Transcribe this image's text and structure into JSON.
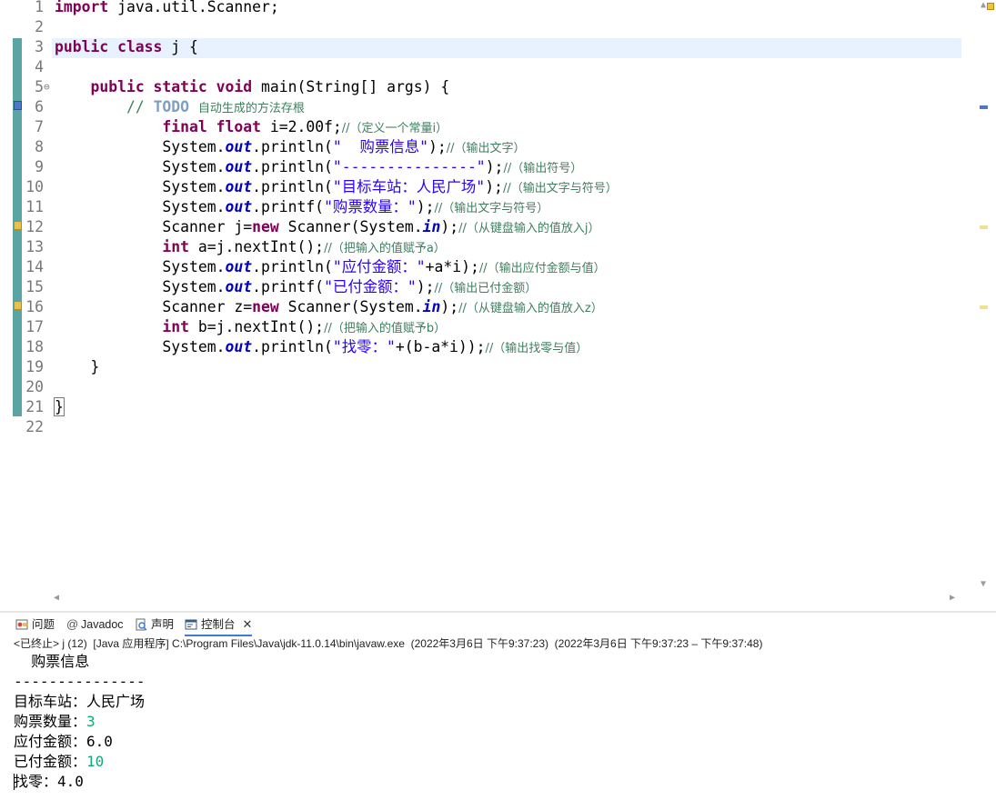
{
  "editor": {
    "lines": [
      {
        "num": "1",
        "segs": [
          {
            "t": "import",
            "c": "kw"
          },
          {
            "t": " java.util.Scanner;",
            "c": ""
          }
        ]
      },
      {
        "num": "2",
        "segs": []
      },
      {
        "num": "3",
        "segs": [
          {
            "t": "public class",
            "c": "kw"
          },
          {
            "t": " j {",
            "c": ""
          }
        ]
      },
      {
        "num": "4",
        "segs": []
      },
      {
        "num": "5",
        "fold": "⊖",
        "segs": [
          {
            "t": "    ",
            "c": ""
          },
          {
            "t": "public static void",
            "c": "kw"
          },
          {
            "t": " main(String[] ",
            "c": ""
          },
          {
            "t": "args",
            "c": "var"
          },
          {
            "t": ") {",
            "c": ""
          }
        ]
      },
      {
        "num": "6",
        "segs": [
          {
            "t": "        ",
            "c": ""
          },
          {
            "t": "// ",
            "c": "cmt"
          },
          {
            "t": "TODO",
            "c": "todo"
          },
          {
            "t": " ",
            "c": "cmt"
          },
          {
            "t": "自动生成的方法存根",
            "c": "cmt cn"
          }
        ]
      },
      {
        "num": "7",
        "segs": [
          {
            "t": "            ",
            "c": ""
          },
          {
            "t": "final float",
            "c": "kw"
          },
          {
            "t": " i=2.00f;",
            "c": ""
          },
          {
            "t": "//（定义一个常量i）",
            "c": "cmt cn"
          }
        ]
      },
      {
        "num": "8",
        "segs": [
          {
            "t": "            System.",
            "c": ""
          },
          {
            "t": "out",
            "c": "fld"
          },
          {
            "t": ".println(",
            "c": ""
          },
          {
            "t": "\"  购票信息\"",
            "c": "str"
          },
          {
            "t": ");",
            "c": ""
          },
          {
            "t": "//（输出文字）",
            "c": "cmt cn"
          }
        ]
      },
      {
        "num": "9",
        "segs": [
          {
            "t": "            System.",
            "c": ""
          },
          {
            "t": "out",
            "c": "fld"
          },
          {
            "t": ".println(",
            "c": ""
          },
          {
            "t": "\"---------------\"",
            "c": "str"
          },
          {
            "t": ");",
            "c": ""
          },
          {
            "t": "//（输出符号）",
            "c": "cmt cn"
          }
        ]
      },
      {
        "num": "10",
        "segs": [
          {
            "t": "            System.",
            "c": ""
          },
          {
            "t": "out",
            "c": "fld"
          },
          {
            "t": ".println(",
            "c": ""
          },
          {
            "t": "\"目标车站：人民广场\"",
            "c": "str"
          },
          {
            "t": ");",
            "c": ""
          },
          {
            "t": "//（输出文字与符号）",
            "c": "cmt cn"
          }
        ]
      },
      {
        "num": "11",
        "segs": [
          {
            "t": "            System.",
            "c": ""
          },
          {
            "t": "out",
            "c": "fld"
          },
          {
            "t": ".printf(",
            "c": ""
          },
          {
            "t": "\"购票数量：\"",
            "c": "str"
          },
          {
            "t": ");",
            "c": ""
          },
          {
            "t": "//（输出文字与符号）",
            "c": "cmt cn"
          }
        ]
      },
      {
        "num": "12",
        "segs": [
          {
            "t": "            Scanner j=",
            "c": ""
          },
          {
            "t": "new",
            "c": "kw"
          },
          {
            "t": " Scanner(System.",
            "c": ""
          },
          {
            "t": "in",
            "c": "fld"
          },
          {
            "t": ");",
            "c": ""
          },
          {
            "t": "//（从键盘输入的值放入j）",
            "c": "cmt cn"
          }
        ]
      },
      {
        "num": "13",
        "segs": [
          {
            "t": "            ",
            "c": ""
          },
          {
            "t": "int",
            "c": "kw"
          },
          {
            "t": " a=j.nextInt();",
            "c": ""
          },
          {
            "t": "//（把输入的值赋予a）",
            "c": "cmt cn"
          }
        ]
      },
      {
        "num": "14",
        "segs": [
          {
            "t": "            System.",
            "c": ""
          },
          {
            "t": "out",
            "c": "fld"
          },
          {
            "t": ".println(",
            "c": ""
          },
          {
            "t": "\"应付金额：\"",
            "c": "str"
          },
          {
            "t": "+a*i);",
            "c": ""
          },
          {
            "t": "//（输出应付金额与值）",
            "c": "cmt cn"
          }
        ]
      },
      {
        "num": "15",
        "segs": [
          {
            "t": "            System.",
            "c": ""
          },
          {
            "t": "out",
            "c": "fld"
          },
          {
            "t": ".printf(",
            "c": ""
          },
          {
            "t": "\"已付金额：\"",
            "c": "str"
          },
          {
            "t": ");",
            "c": ""
          },
          {
            "t": "//（输出已付金额）",
            "c": "cmt cn"
          }
        ]
      },
      {
        "num": "16",
        "segs": [
          {
            "t": "            Scanner z=",
            "c": ""
          },
          {
            "t": "new",
            "c": "kw"
          },
          {
            "t": " Scanner(System.",
            "c": ""
          },
          {
            "t": "in",
            "c": "fld"
          },
          {
            "t": ");",
            "c": ""
          },
          {
            "t": "//（从键盘输入的值放入z）",
            "c": "cmt cn"
          }
        ]
      },
      {
        "num": "17",
        "segs": [
          {
            "t": "            ",
            "c": ""
          },
          {
            "t": "int",
            "c": "kw"
          },
          {
            "t": " b=j.nextInt();",
            "c": ""
          },
          {
            "t": "//（把输入的值赋予b）",
            "c": "cmt cn"
          }
        ]
      },
      {
        "num": "18",
        "segs": [
          {
            "t": "            System.",
            "c": ""
          },
          {
            "t": "out",
            "c": "fld"
          },
          {
            "t": ".println(",
            "c": ""
          },
          {
            "t": "\"找零：\"",
            "c": "str"
          },
          {
            "t": "+(b-a*i));",
            "c": ""
          },
          {
            "t": "//（输出找零与值）",
            "c": "cmt cn"
          }
        ]
      },
      {
        "num": "19",
        "segs": [
          {
            "t": "    }",
            "c": ""
          }
        ]
      },
      {
        "num": "20",
        "segs": []
      },
      {
        "num": "21",
        "segs": [
          {
            "t": "}",
            "c": "bracket"
          }
        ]
      },
      {
        "num": "22",
        "segs": []
      }
    ]
  },
  "views": {
    "tabs": [
      {
        "label": "问题",
        "icon": "problems-icon"
      },
      {
        "label": "Javadoc",
        "icon": "javadoc-icon"
      },
      {
        "label": "声明",
        "icon": "declaration-icon"
      },
      {
        "label": "控制台",
        "icon": "console-icon",
        "active": true
      }
    ],
    "close": "✕"
  },
  "console": {
    "info": "<已终止> j (12)  [Java 应用程序] C:\\Program Files\\Java\\jdk-11.0.14\\bin\\javaw.exe  (2022年3月6日 下午9:37:23)  (2022年3月6日 下午9:37:23 – 下午9:37:48)",
    "lines": [
      {
        "segs": [
          {
            "t": "  购票信息",
            "c": ""
          }
        ]
      },
      {
        "segs": [
          {
            "t": "---------------",
            "c": ""
          }
        ]
      },
      {
        "segs": [
          {
            "t": "目标车站：人民广场",
            "c": ""
          }
        ]
      },
      {
        "segs": [
          {
            "t": "购票数量：",
            "c": ""
          },
          {
            "t": "3",
            "c": "in"
          }
        ]
      },
      {
        "segs": [
          {
            "t": "应付金额：6.0",
            "c": ""
          }
        ]
      },
      {
        "segs": [
          {
            "t": "已付金额：",
            "c": ""
          },
          {
            "t": "10",
            "c": "in"
          }
        ]
      },
      {
        "segs": [
          {
            "t": "找零：4.0",
            "c": ""
          }
        ]
      }
    ]
  },
  "colors": {
    "keyword": "#7f0055",
    "string": "#2a00ff",
    "comment": "#3f7f5f",
    "field": "#0000c0",
    "input": "#13a77a"
  }
}
